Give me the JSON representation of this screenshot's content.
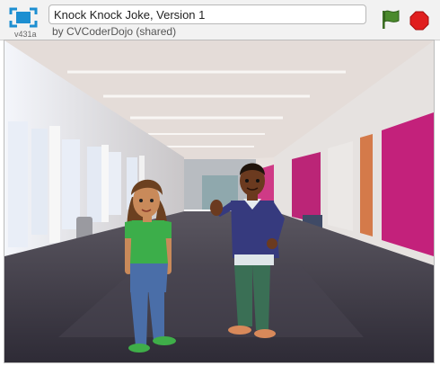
{
  "header": {
    "project_title": "Knock Knock Joke, Version 1",
    "byline": "by CVCoderDojo (shared)",
    "version": "v431a"
  },
  "controls": {
    "fullscreen_icon": "fullscreen-icon",
    "green_flag_icon": "green-flag-icon",
    "stop_icon": "stop-sign-icon"
  },
  "stage": {
    "backdrop": "hallway",
    "sprites": [
      "girl",
      "boy"
    ]
  },
  "colors": {
    "toolbar_bg": "#f2f2f2",
    "accent_blue": "#1d8fd1",
    "flag_green": "#4a8a2c",
    "stop_red": "#e01e1e",
    "wall_magenta": "#c3217b",
    "floor": "#3e3a44"
  }
}
